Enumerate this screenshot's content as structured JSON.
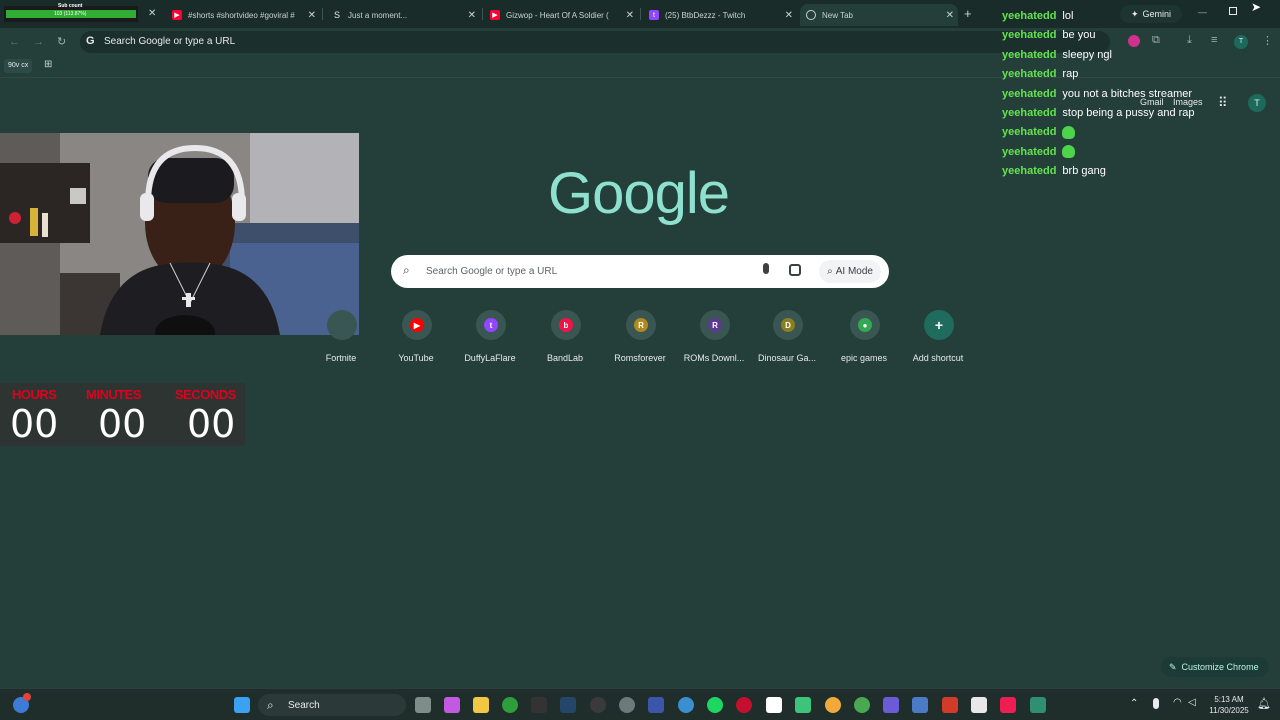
{
  "tabs": [
    {
      "title": "",
      "overlay": "Sub count",
      "progress_text": "103 (113.87%)",
      "favicon": "progress-bar"
    },
    {
      "title": "#shorts #shortvideo #goviral #",
      "favicon": "youtube-icon"
    },
    {
      "title": "Just a moment...",
      "favicon": "loading-icon"
    },
    {
      "title": "Gizwop - Heart Of A Soldier (",
      "favicon": "youtube-icon"
    },
    {
      "title": "(25) BtbDezzz - Twitch",
      "favicon": "twitch-icon"
    },
    {
      "title": "New Tab",
      "favicon": "chrome-icon"
    }
  ],
  "toolbar": {
    "omnibox_placeholder": "Search Google or type a URL",
    "gemini_label": "Gemini",
    "profile_initial": "T"
  },
  "bookmarks": {
    "item1": "90v cx"
  },
  "google": {
    "logo": "Google",
    "search_placeholder": "Search Google or type a URL",
    "ai_mode": "AI Mode",
    "gmail": "Gmail",
    "images": "Images",
    "account_initial": "T"
  },
  "shortcuts": [
    {
      "label": "Fortnite",
      "icon": "fortnite-icon",
      "color": "#3a5652",
      "glyph": ""
    },
    {
      "label": "YouTube",
      "icon": "youtube-icon",
      "color": "#ff0000",
      "glyph": "▶"
    },
    {
      "label": "DuffyLaFlare",
      "icon": "twitch-icon",
      "color": "#9146ff",
      "glyph": "t"
    },
    {
      "label": "BandLab",
      "icon": "bandlab-icon",
      "color": "#f01446",
      "glyph": "b"
    },
    {
      "label": "Romsforever",
      "icon": "letter-r-icon",
      "color": "#b08a1e",
      "glyph": "R"
    },
    {
      "label": "ROMs Downl...",
      "icon": "roms-icon",
      "color": "#5b3a8f",
      "glyph": "R"
    },
    {
      "label": "Dinosaur Ga...",
      "icon": "letter-d-icon",
      "color": "#8a7d22",
      "glyph": "D"
    },
    {
      "label": "epic games",
      "icon": "maps-pin-icon",
      "color": "#34a853",
      "glyph": "●"
    },
    {
      "label": "Add shortcut",
      "icon": "plus-icon",
      "color": "#1f6b5e",
      "glyph": "+"
    }
  ],
  "timer": {
    "hours_label": "HOURS",
    "minutes_label": "MINUTES",
    "seconds_label": "SECONDS",
    "hours": "00",
    "minutes": "00",
    "seconds": "00"
  },
  "chat": [
    {
      "user": "yeehatedd",
      "msg": "lol"
    },
    {
      "user": "yeehatedd",
      "msg": "be you"
    },
    {
      "user": "yeehatedd",
      "msg": "sleepy ngl"
    },
    {
      "user": "yeehatedd",
      "msg": "rap"
    },
    {
      "user": "yeehatedd",
      "msg": "you not a bitches streamer"
    },
    {
      "user": "yeehatedd",
      "msg": "stop being a pussy and rap"
    },
    {
      "user": "yeehatedd",
      "msg": ""
    },
    {
      "user": "yeehatedd",
      "msg": ""
    },
    {
      "user": "yeehatedd",
      "msg": "brb gang"
    }
  ],
  "customize": "Customize Chrome",
  "taskbar": {
    "search": "Search",
    "time": "5:13 AM",
    "date": "11/30/2025"
  },
  "colors": {
    "background": "#243e3a",
    "chat_user": "#64e34e",
    "timer_label": "#e0001b",
    "google_logo": "#8ee0cf"
  }
}
